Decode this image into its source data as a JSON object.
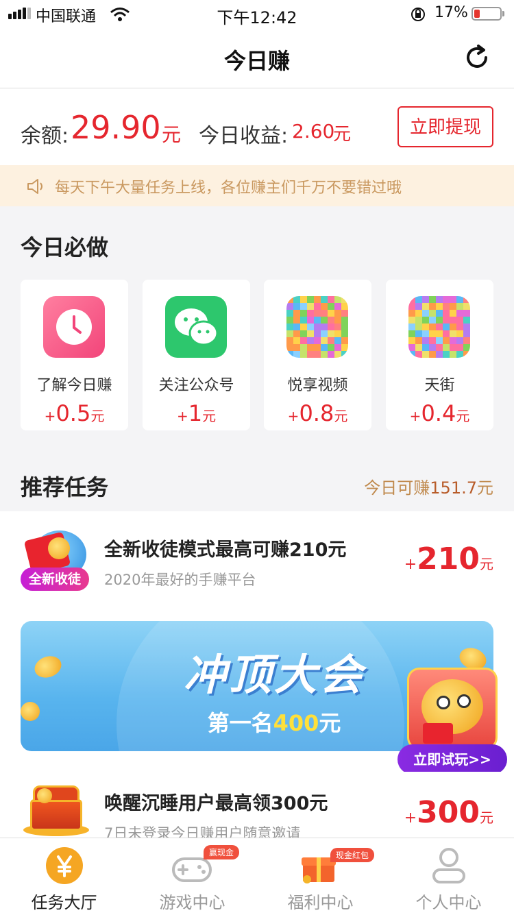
{
  "status": {
    "carrier": "中国联通",
    "time": "下午12:42",
    "battery": "17%"
  },
  "nav": {
    "title": "今日赚"
  },
  "balance": {
    "label": "余额:",
    "value": "29.90",
    "unit": "元",
    "income_label": "今日收益:",
    "income_value": "2.60",
    "income_unit": "元",
    "withdraw_label": "立即提现"
  },
  "notice": {
    "text": "每天下午大量任务上线，各位赚主们千万不要错过哦"
  },
  "must_do": {
    "title": "今日必做",
    "cards": [
      {
        "name": "了解今日赚",
        "plus": "+",
        "amount": "0.5",
        "unit": "元",
        "icon": "clock-icon"
      },
      {
        "name": "关注公众号",
        "plus": "+",
        "amount": "1",
        "unit": "元",
        "icon": "wechat-icon"
      },
      {
        "name": "悦享视频",
        "plus": "+",
        "amount": "0.8",
        "unit": "元",
        "icon": "mosaic-app-icon"
      },
      {
        "name": "天街",
        "plus": "+",
        "amount": "0.4",
        "unit": "元",
        "icon": "mosaic-app-icon"
      }
    ]
  },
  "recommend": {
    "title": "推荐任务",
    "today_label": "今日可赚",
    "today_value": "151.7",
    "today_unit": "元",
    "tasks": [
      {
        "title": "全新收徒模式最高可赚210元",
        "subtitle": "2020年最好的手赚平台",
        "plus": "+",
        "amount": "210",
        "unit": "元",
        "badge": "全新收徒"
      },
      {
        "title": "唤醒沉睡用户最高领300元",
        "subtitle": "7日未登录今日赚用户随意邀请",
        "plus": "+",
        "amount": "300",
        "unit": "元"
      }
    ]
  },
  "banner": {
    "title": "冲顶大会",
    "sub_prefix": "第一名",
    "sub_highlight": "400",
    "sub_suffix": "元",
    "try_label": "立即试玩>>"
  },
  "tabs": [
    {
      "label": "任务大厅",
      "icon": "yen-icon",
      "active": true
    },
    {
      "label": "游戏中心",
      "icon": "gamepad-icon",
      "badge": "赢现金"
    },
    {
      "label": "福利中心",
      "icon": "gift-icon",
      "badge": "现金红包"
    },
    {
      "label": "个人中心",
      "icon": "person-icon"
    }
  ],
  "colors": {
    "accent": "#e5262e",
    "notice_bg": "#fdf1e0",
    "gold": "#f5a623",
    "promo_purple": "#7a24d8"
  }
}
